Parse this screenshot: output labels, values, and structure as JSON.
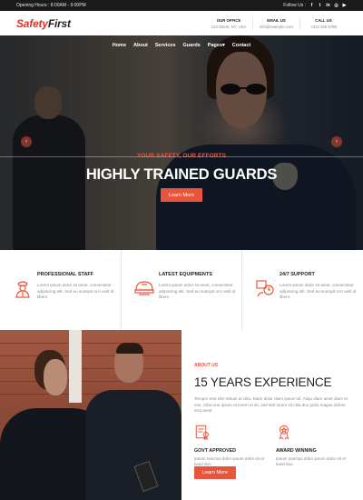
{
  "topbar": {
    "hours": "Opening Hours : 8:00AM - 9:00PM",
    "follow": "Follow Us :",
    "social_icons": [
      "facebook-icon",
      "twitter-icon",
      "linkedin-icon",
      "instagram-icon",
      "youtube-icon"
    ]
  },
  "header": {
    "logo_part1": "Safety",
    "logo_part2": "First",
    "contacts": [
      {
        "label": "OUR OFFICE",
        "value": "123 Street, NY, USA"
      },
      {
        "label": "EMAIL US",
        "value": "info@example.com"
      },
      {
        "label": "CALL US",
        "value": "+012 345 6789"
      }
    ]
  },
  "nav": {
    "items": [
      "Home",
      "About",
      "Services",
      "Guards",
      "Pages",
      "Contact"
    ],
    "dropdown_marker": "▾"
  },
  "hero": {
    "kicker": "YOUR SAFETY, OUR EFFORTS",
    "title": "HIGHLY TRAINED GUARDS",
    "button": "Learn More",
    "prev": "‹",
    "next": "›"
  },
  "features": [
    {
      "title": "PROFESSIONAL STAFF",
      "text": "Lorem ipsum dolor sit amet, consectetur adipiscing elit. Sed eu suscipit orci velit id libero",
      "icon": "guard-icon"
    },
    {
      "title": "LATEST EQUIPMENTS",
      "text": "Lorem ipsum dolor sit amet, consectetur adipiscing elit. Sed eu suscipit orci velit id libero",
      "icon": "helmet-icon"
    },
    {
      "title": "24/7 SUPPORT",
      "text": "Lorem ipsum dolor sit amet, consectetur adipiscing elit. Sed eu suscipit orci velit id libero",
      "icon": "support-icon"
    }
  ],
  "about": {
    "kicker": "ABOUT US",
    "title": "15 YEARS EXPERIENCE",
    "desc": "Tempor erat elitr rebum at clita. Diam dolor diam ipsum sit. Aliqu diam amet diam et eos. Clita erat ipsum et lorem et sit, sed stet lorem sit clita duo justo magna dolore erat amet",
    "items": [
      {
        "title": "GOVT APPROVED",
        "text": "Ipsum sanctus dolor ipsum dolor sit et kasd duo",
        "icon": "certificate-icon"
      },
      {
        "title": "AWARD WINNING",
        "text": "Ipsum sanctus dolor ipsum dolor sit et kasd duo",
        "icon": "award-icon"
      }
    ],
    "button": "Learn More"
  },
  "colors": {
    "accent": "#e8553c",
    "dark": "#1a1a1a"
  }
}
